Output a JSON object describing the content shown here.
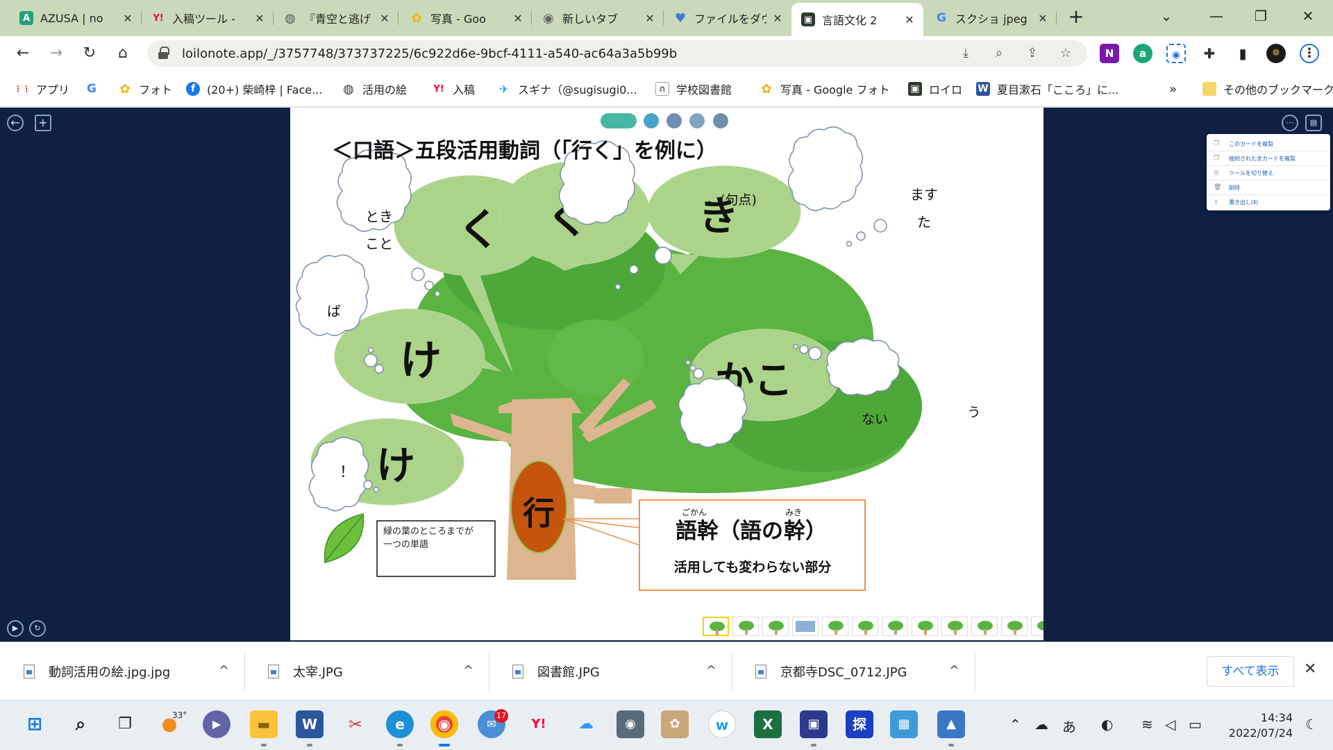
{
  "browser": {
    "tabs": [
      {
        "label": "AZUSA | no",
        "icon": "A",
        "color": "#24a078"
      },
      {
        "label": "入稿ツール -",
        "icon": "Y!",
        "color": "#ff0033"
      },
      {
        "label": "『青空と逃げ",
        "icon": "◍",
        "color": "#555555"
      },
      {
        "label": "写真 - Goo",
        "icon": "✿",
        "color": "#f4b400"
      },
      {
        "label": "新しいタブ",
        "icon": "◉",
        "color": "#666666"
      },
      {
        "label": "ファイルをダウ",
        "icon": "♥",
        "color": "#3a7bd5"
      },
      {
        "label": "言語文化 2",
        "icon": "▣",
        "color": "#2d3a2e"
      },
      {
        "label": "スクショ jpeg",
        "icon": "G",
        "color": "#4285f4"
      }
    ],
    "new_tab": "+",
    "window_controls": {
      "dropdown": "⌄",
      "minimize": "—",
      "restore": "❐",
      "close": "✕"
    },
    "url": "loilonote.app/_/3757748/373737225/6c922d6e-9bcf-4111-a540-ac64a3a5b99b",
    "nav": {
      "back": "←",
      "forward": "→",
      "reload": "↻",
      "home": "⌂"
    },
    "bookmarks": [
      {
        "label": "アプリ",
        "icon": "⋮⋮",
        "color": "#ea4335"
      },
      {
        "label": "",
        "icon": "G",
        "color": "#4285f4"
      },
      {
        "label": "フォト",
        "icon": "✿",
        "color": "#f4b400"
      },
      {
        "label": "(20+) 柴崎梓 | Face...",
        "icon": "f",
        "color": "#1877f2"
      },
      {
        "label": "活用の絵",
        "icon": "◍",
        "color": "#333333"
      },
      {
        "label": "入稿",
        "icon": "Y!",
        "color": "#ff0033"
      },
      {
        "label": "スギナ（@sugisugi0...",
        "icon": "✈",
        "color": "#1da1f2"
      },
      {
        "label": "学校図書館",
        "icon": "∩",
        "color": "#777777"
      },
      {
        "label": "写真 - Google フォト",
        "icon": "✿",
        "color": "#f4b400"
      },
      {
        "label": "ロイロ",
        "icon": "▣",
        "color": "#2d3a2e"
      },
      {
        "label": "夏目漱石「こころ」に...",
        "icon": "W",
        "color": "#2b579a"
      }
    ],
    "bookmarks_more": "»",
    "other_bookmarks": "その他のブックマーク"
  },
  "slide": {
    "title": "＜口語＞五段活用動詞（「行く」を例に）",
    "stem_char": "行",
    "speech_bubbles": {
      "ka": "く",
      "ku1": "く",
      "ki": "き",
      "ke1": "け",
      "kako": "かこ",
      "ke2": "け"
    },
    "thought_bubbles": {
      "toki": [
        "とき",
        "こと"
      ],
      "kuten": "。(句点)",
      "masu": [
        "ます",
        "た"
      ],
      "ba": "ば",
      "nai": "ない",
      "u": "う",
      "excl": "！"
    },
    "leaf_note": [
      "緑の葉のところまでが",
      "一つの単語"
    ],
    "gokan": {
      "kanji_1": "語幹",
      "ruby_1": "ごかん",
      "mid": "（語の",
      "kanji_2": "幹",
      "ruby_2": "みき",
      "end": "）",
      "desc": "活用しても変わらない部分"
    }
  },
  "context_menu": [
    "このカードを複製",
    "接続された全カードを複製",
    "ツールを切り替え",
    "削除",
    "書き出し(Ⅱ)"
  ],
  "downloads": [
    {
      "name": "動詞活用の絵.jpg.jpg"
    },
    {
      "name": "太宰.JPG"
    },
    {
      "name": "図書館.JPG"
    },
    {
      "name": "京都寺DSC_0712.JPG"
    }
  ],
  "downloads_show_all": "すべて表示",
  "taskbar": {
    "weather": "33°",
    "badge": "17",
    "ime": "あ",
    "time": "14:34",
    "date": "2022/07/24"
  },
  "colors": {
    "app_bg": "#0f2043",
    "leaf_bubble": "#acd38a",
    "tree_green": "#5bb342",
    "trunk": "#dcb68f",
    "stem_oval": "#c4540e",
    "callout_border": "#e7924f"
  }
}
